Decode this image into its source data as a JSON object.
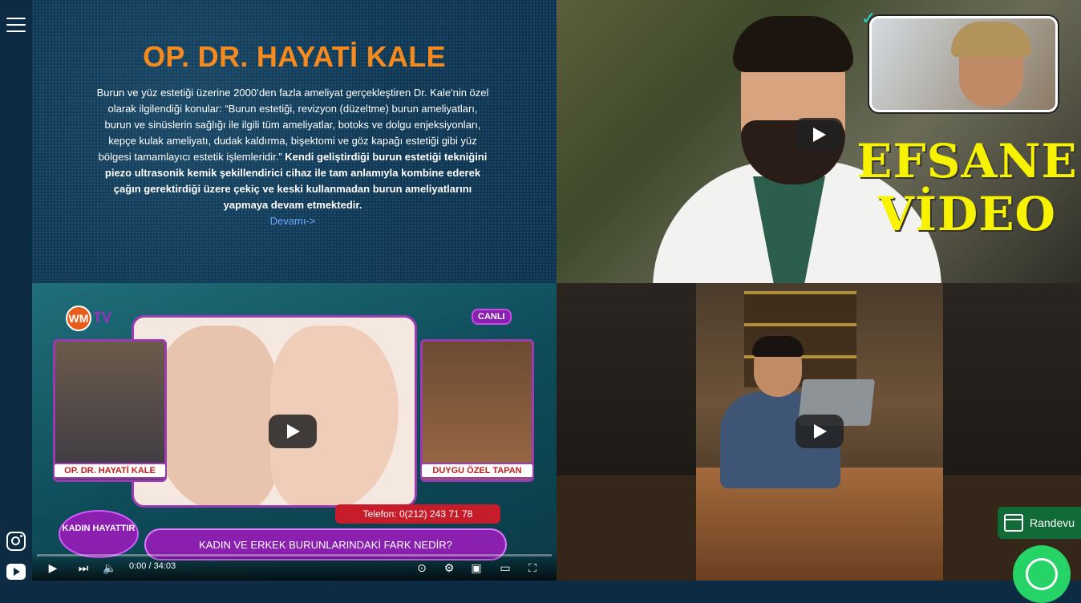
{
  "sidebar": {
    "menu_icon": "hamburger-menu-icon",
    "social": [
      "instagram-icon",
      "youtube-icon"
    ]
  },
  "intro": {
    "title": "OP. DR. HAYATİ KALE",
    "text_regular": "Burun ve yüz estetiği üzerine 2000’den fazla ameliyat gerçekleştiren Dr. Kale'nin özel olarak ilgilendiği konular: “Burun estetiği, revizyon (düzeltme) burun ameliyatları, burun ve sinüslerin sağlığı ile ilgili tüm ameliyatlar, botoks ve dolgu enjeksiyonları, kepçe kulak ameliyatı, dudak kaldırma, bişektomi ve göz kapağı estetiği gibi yüz bölgesi tamamlayıcı estetik işlemleridir.”",
    "text_bold": "Kendi geliştirdiği burun estetiği tekniğini piezo ultrasonik kemik şekillendirici cihaz ile tam anlamıyla kombine ederek çağın gerektirdiği üzere çekiç ve keski kullanmadan burun ameliyatlarını yapmaya devam etmektedir.",
    "more_link": "Devamı->"
  },
  "video1": {
    "overlay_text": "EFSANE VİDEO"
  },
  "video2": {
    "logo_text": "TV",
    "logo_mark": "WM",
    "live_badge": "CANLI",
    "left_label": "OP. DR. HAYATİ KALE",
    "right_label": "DUYGU ÖZEL TAPAN",
    "phone": "Telefon: 0(212) 243 71 78",
    "program": "KADIN HAYATTIR",
    "question": "KADIN VE ERKEK BURUNLARINDAKİ FARK NEDİR?",
    "time": "0:00 / 34:03",
    "progress": 0
  },
  "video3": {},
  "floating": {
    "appointment_label": "Randevu",
    "whatsapp_icon": "whatsapp-icon"
  },
  "colors": {
    "title": "#f58a1f",
    "efsane": "#f7f200",
    "appointment_bg": "#116b37",
    "whatsapp": "#25d366"
  }
}
